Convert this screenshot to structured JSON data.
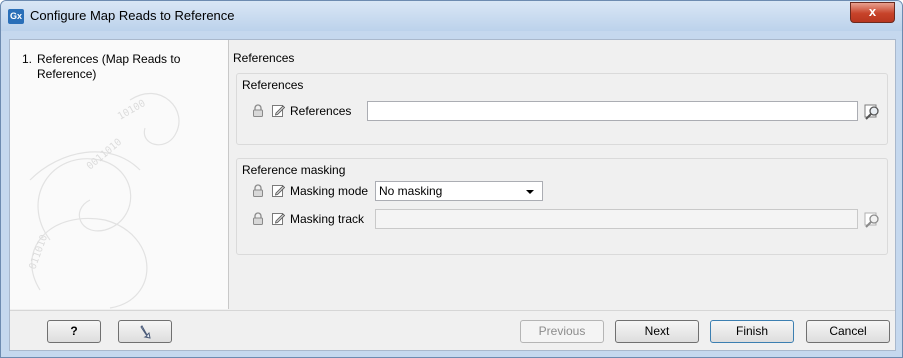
{
  "window": {
    "title": "Configure Map Reads to Reference",
    "app_icon": "Gx",
    "close_label": "x"
  },
  "steps": [
    {
      "number": "1.",
      "label": "References (Map Reads to Reference)"
    }
  ],
  "panel": {
    "title": "References"
  },
  "references_group": {
    "title": "References",
    "field": {
      "label": "References",
      "value": ""
    }
  },
  "masking_group": {
    "title": "Reference masking",
    "mode": {
      "label": "Masking mode",
      "value": "No masking"
    },
    "track": {
      "label": "Masking track",
      "value": ""
    }
  },
  "buttons": {
    "help": "?",
    "previous": "Previous",
    "next": "Next",
    "finish": "Finish",
    "cancel": "Cancel"
  },
  "icons": {
    "lock": "lock-icon",
    "edit": "pencil-icon",
    "browse": "browse-icon",
    "reset": "reset-arrow-icon"
  }
}
